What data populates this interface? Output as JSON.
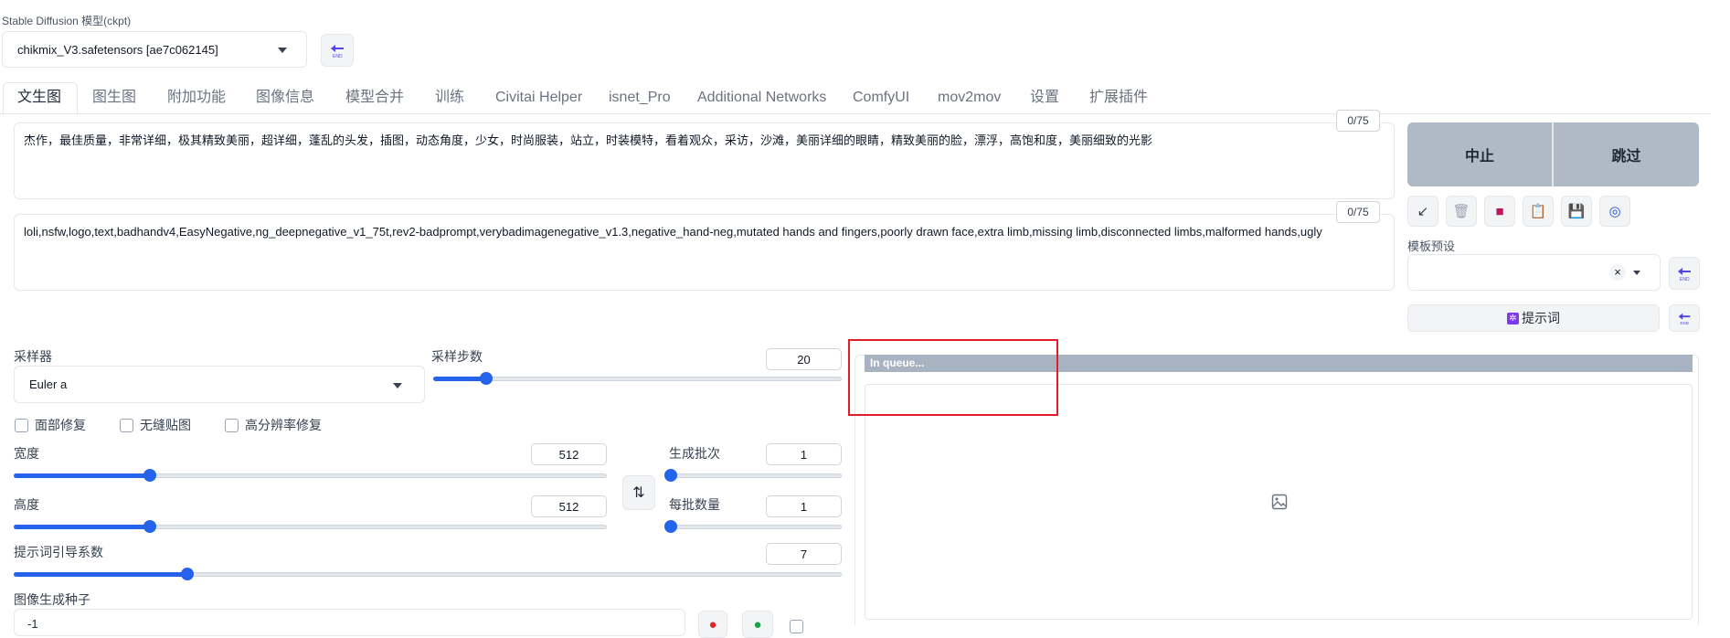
{
  "model": {
    "label": "Stable Diffusion 模型(ckpt)",
    "value": "chikmix_V3.safetensors [ae7c062145]"
  },
  "tabs": [
    "文生图",
    "图生图",
    "附加功能",
    "图像信息",
    "模型合并",
    "训练",
    "Civitai Helper",
    "isnet_Pro",
    "Additional Networks",
    "ComfyUI",
    "mov2mov",
    "设置",
    "扩展插件"
  ],
  "prompt": {
    "counter": "0/75",
    "text": "杰作，最佳质量，非常详细，极其精致美丽，超详细，蓬乱的头发，插图，动态角度，少女，时尚服装，站立，时装模特，看着观众，采访，沙滩，美丽详细的眼睛，精致美丽的脸，漂浮，高饱和度，美丽细致的光影"
  },
  "negative_prompt": {
    "counter": "0/75",
    "text": "loli,nsfw,logo,text,badhandv4,EasyNegative,ng_deepnegative_v1_75t,rev2-badprompt,verybadimagenegative_v1.3,negative_hand-neg,mutated hands and fingers,poorly drawn face,extra limb,missing limb,disconnected limbs,malformed hands,ugly"
  },
  "actions": {
    "interrupt": "中止",
    "skip": "跳过"
  },
  "styles": {
    "label": "模板预设",
    "clear": "×",
    "prompt_button": "提示词"
  },
  "sampler": {
    "label": "采样器",
    "value": "Euler a"
  },
  "steps": {
    "label": "采样步数",
    "value": "20",
    "fraction": 0.13
  },
  "checkboxes": {
    "restore_faces": "面部修复",
    "tiling": "无缝贴图",
    "hires_fix": "高分辨率修复"
  },
  "width": {
    "label": "宽度",
    "value": "512",
    "fraction": 0.23
  },
  "height": {
    "label": "高度",
    "value": "512",
    "fraction": 0.23
  },
  "batch_count": {
    "label": "生成批次",
    "value": "1",
    "fraction": 0.0
  },
  "batch_size": {
    "label": "每批数量",
    "value": "1",
    "fraction": 0.0
  },
  "cfg": {
    "label": "提示词引导系数",
    "value": "7",
    "fraction": 0.21
  },
  "seed": {
    "label": "图像生成种子",
    "value": "-1"
  },
  "output": {
    "status": "In queue..."
  },
  "colors": {
    "accent": "#2563eb",
    "progress_bar": "#a8b3c1",
    "highlight": "#e11d2a",
    "action_button": "#b0bac6"
  }
}
